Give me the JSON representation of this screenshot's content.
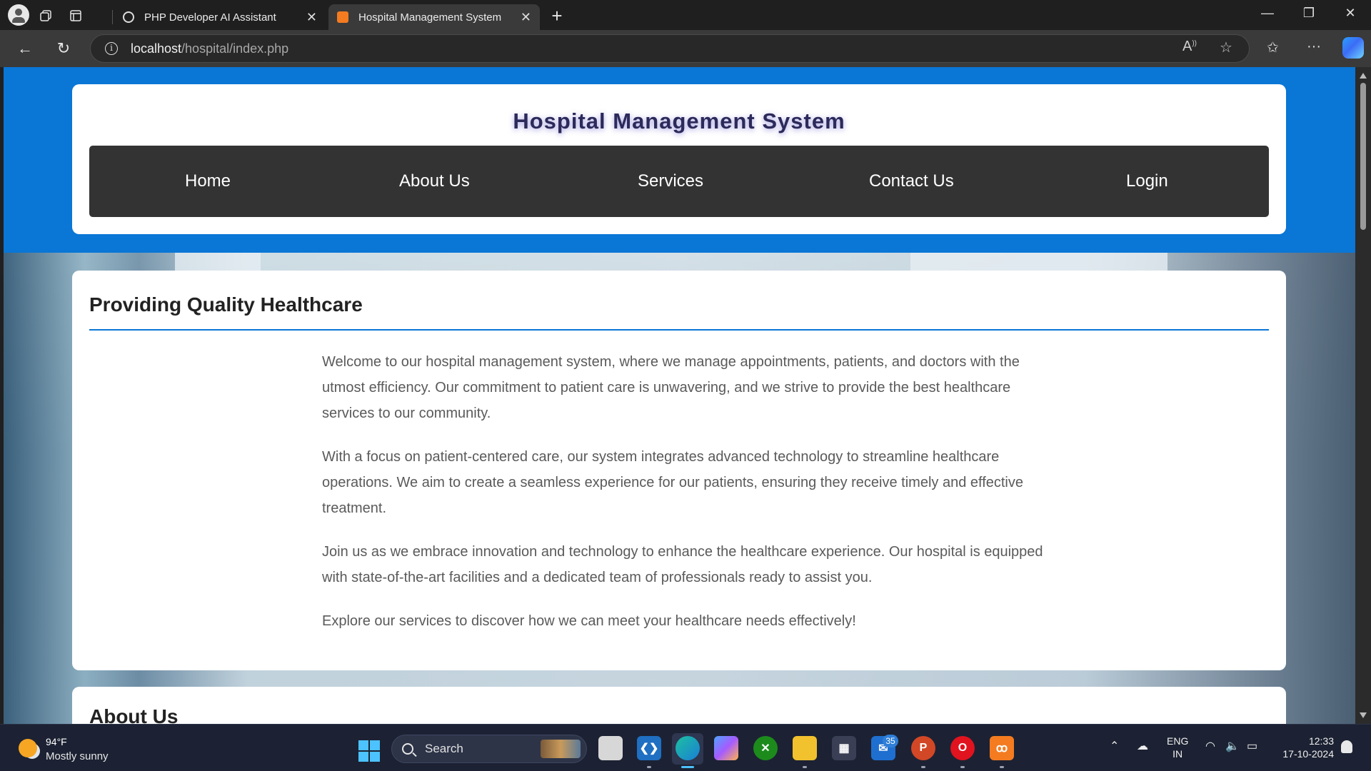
{
  "browser": {
    "tabs": [
      {
        "label": "PHP Developer AI Assistant",
        "active": false
      },
      {
        "label": "Hospital Management System",
        "active": true
      }
    ],
    "url_host": "localhost",
    "url_path": "/hospital/index.php"
  },
  "site": {
    "title": "Hospital Management System",
    "nav": [
      "Home",
      "About Us",
      "Services",
      "Contact Us",
      "Login"
    ],
    "accent_color": "#0a76d6",
    "nav_bg_color": "#333333"
  },
  "intro": {
    "heading": "Providing Quality Healthcare",
    "paragraphs": [
      "Welcome to our hospital management system, where we manage appointments, patients, and doctors with the utmost efficiency. Our commitment to patient care is unwavering, and we strive to provide the best healthcare services to our community.",
      "With a focus on patient-centered care, our system integrates advanced technology to streamline healthcare operations. We aim to create a seamless experience for our patients, ensuring they receive timely and effective treatment.",
      "Join us as we embrace innovation and technology to enhance the healthcare experience. Our hospital is equipped with state-of-the-art facilities and a dedicated team of professionals ready to assist you.",
      "Explore our services to discover how we can meet your healthcare needs effectively!"
    ]
  },
  "about": {
    "heading": "About Us"
  },
  "taskbar": {
    "weather_temp": "94°F",
    "weather_desc": "Mostly sunny",
    "search_label": "Search",
    "mail_badge": "35",
    "lang_line1": "ENG",
    "lang_line2": "IN",
    "time": "12:33",
    "date": "17-10-2024"
  }
}
